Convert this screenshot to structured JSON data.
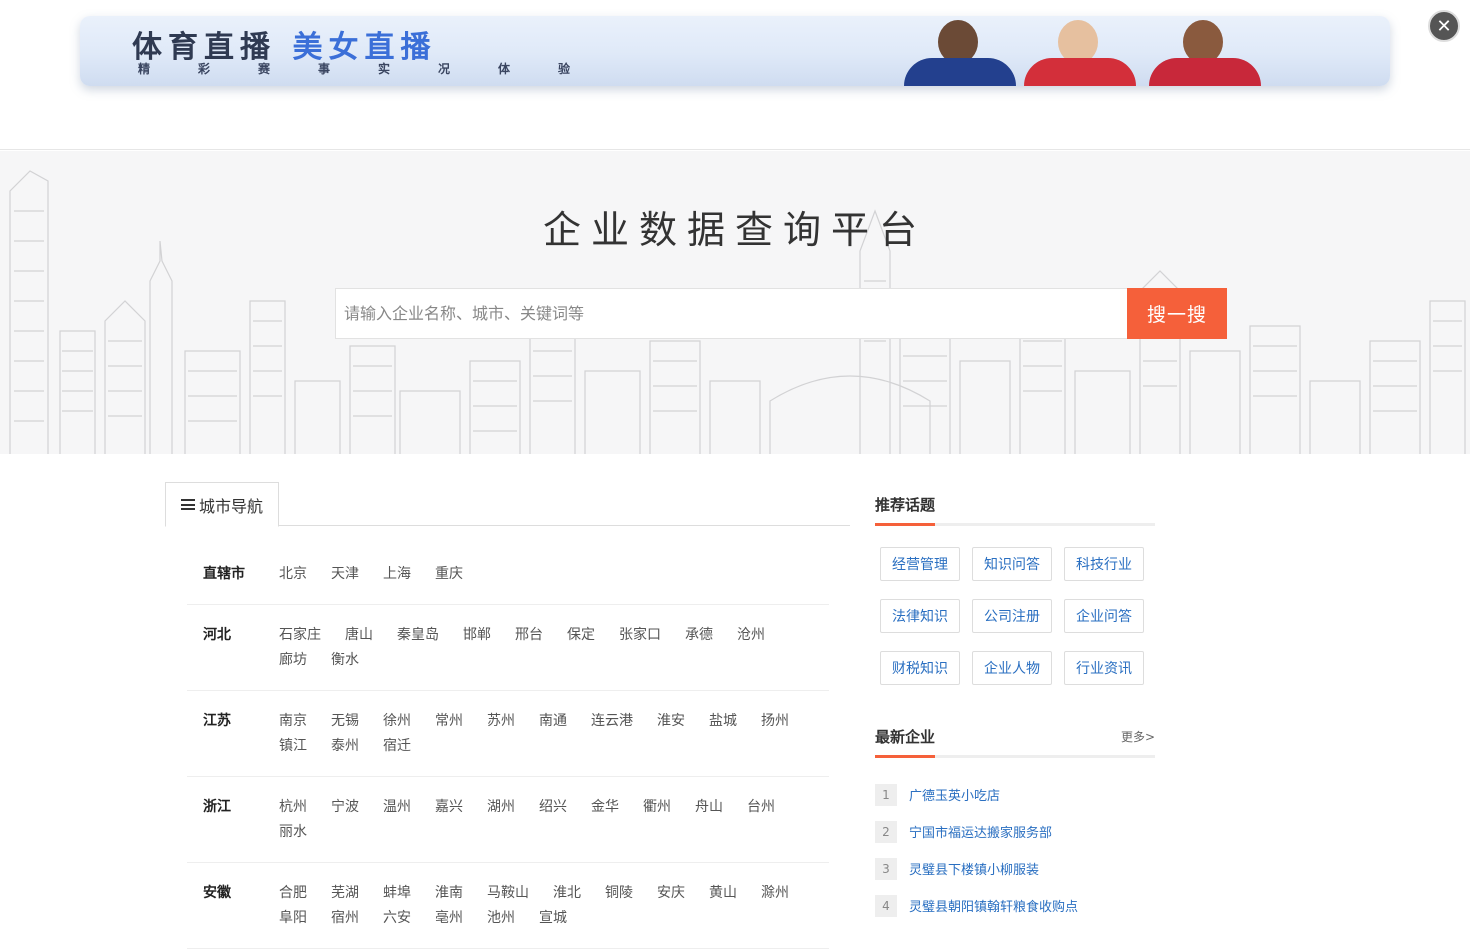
{
  "ad": {
    "title_part1": "体育直播",
    "title_part2": "美女直播",
    "subtitle": "精彩赛事实况体验",
    "close_label": "✕"
  },
  "hero": {
    "title": "企业数据查询平台",
    "search_placeholder": "请输入企业名称、城市、关键词等",
    "search_button": "搜一搜"
  },
  "city_nav": {
    "tab_label": "城市导航",
    "regions": [
      {
        "name": "直辖市",
        "cities": [
          "北京",
          "天津",
          "上海",
          "重庆"
        ]
      },
      {
        "name": "河北",
        "cities": [
          "石家庄",
          "唐山",
          "秦皇岛",
          "邯郸",
          "邢台",
          "保定",
          "张家口",
          "承德",
          "沧州",
          "廊坊",
          "衡水"
        ]
      },
      {
        "name": "江苏",
        "cities": [
          "南京",
          "无锡",
          "徐州",
          "常州",
          "苏州",
          "南通",
          "连云港",
          "淮安",
          "盐城",
          "扬州",
          "镇江",
          "泰州",
          "宿迁"
        ]
      },
      {
        "name": "浙江",
        "cities": [
          "杭州",
          "宁波",
          "温州",
          "嘉兴",
          "湖州",
          "绍兴",
          "金华",
          "衢州",
          "舟山",
          "台州",
          "丽水"
        ]
      },
      {
        "name": "安徽",
        "cities": [
          "合肥",
          "芜湖",
          "蚌埠",
          "淮南",
          "马鞍山",
          "淮北",
          "铜陵",
          "安庆",
          "黄山",
          "滁州",
          "阜阳",
          "宿州",
          "六安",
          "亳州",
          "池州",
          "宣城"
        ]
      }
    ]
  },
  "sidebar": {
    "topics_title": "推荐话题",
    "topics": [
      "经营管理",
      "知识问答",
      "科技行业",
      "法律知识",
      "公司注册",
      "企业问答",
      "财税知识",
      "企业人物",
      "行业资讯"
    ],
    "latest_title": "最新企业",
    "more_label": "更多>",
    "latest": [
      {
        "num": "1",
        "name": "广德玉英小吃店"
      },
      {
        "num": "2",
        "name": "宁国市福运达搬家服务部"
      },
      {
        "num": "3",
        "name": "灵璧县下楼镇小柳服装"
      },
      {
        "num": "4",
        "name": "灵璧县朝阳镇翰轩粮食收购点"
      }
    ]
  }
}
